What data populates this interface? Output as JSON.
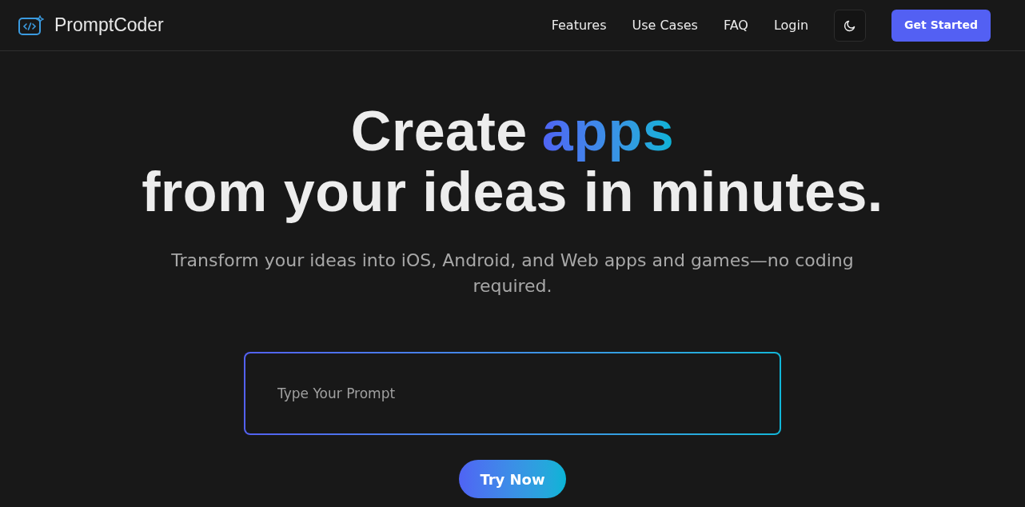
{
  "brand": {
    "name": "PromptCoder"
  },
  "nav": [
    {
      "label": "Features"
    },
    {
      "label": "Use Cases"
    },
    {
      "label": "FAQ"
    },
    {
      "label": "Login"
    }
  ],
  "cta": {
    "label": "Get Started"
  },
  "hero": {
    "headline_lead": "Create",
    "headline_highlight": "apps",
    "headline_line2": "from your ideas in minutes.",
    "subtitle": "Transform your ideas into iOS, Android, and Web apps and games—no coding required."
  },
  "prompt": {
    "placeholder": "Type Your Prompt"
  },
  "try_button": {
    "label": "Try Now"
  }
}
